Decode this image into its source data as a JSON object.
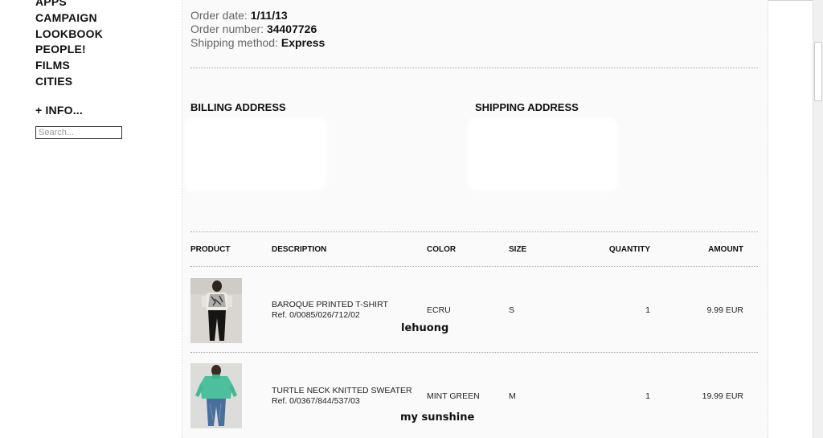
{
  "sidebar": {
    "items": [
      {
        "label": "APPS"
      },
      {
        "label": "CAMPAIGN"
      },
      {
        "label": "LOOKBOOK"
      },
      {
        "label": "PEOPLE!"
      },
      {
        "label": "FILMS"
      },
      {
        "label": "CITIES"
      },
      {
        "label": "+ INFO..."
      }
    ],
    "search_placeholder": "Search..."
  },
  "order": {
    "date_label": "Order date:",
    "date": "1/11/13",
    "number_label": "Order number:",
    "number": "34407726",
    "shipping_label": "Shipping method:",
    "shipping": "Express"
  },
  "addresses": {
    "billing_title": "BILLING ADDRESS",
    "shipping_title": "SHIPPING ADDRESS"
  },
  "table": {
    "headers": {
      "product": "PRODUCT",
      "description": "DESCRIPTION",
      "color": "COLOR",
      "size": "SIZE",
      "quantity": "QUANTITY",
      "amount": "AMOUNT"
    },
    "rows": [
      {
        "name": "BAROQUE PRINTED T-SHIRT",
        "ref": "Ref. 0/0085/026/712/02",
        "color": "ECRU",
        "size": "S",
        "quantity": "1",
        "amount": "9.99 EUR",
        "caption": "lehuong",
        "image_icon": "product-photo-baroque-tshirt"
      },
      {
        "name": "TURTLE NECK KNITTED SWEATER",
        "ref": "Ref. 0/0367/844/537/03",
        "color": "MINT GREEN",
        "size": "M",
        "quantity": "1",
        "amount": "19.99 EUR",
        "caption": "my sunshine",
        "image_icon": "product-photo-turtleneck-sweater"
      }
    ]
  }
}
